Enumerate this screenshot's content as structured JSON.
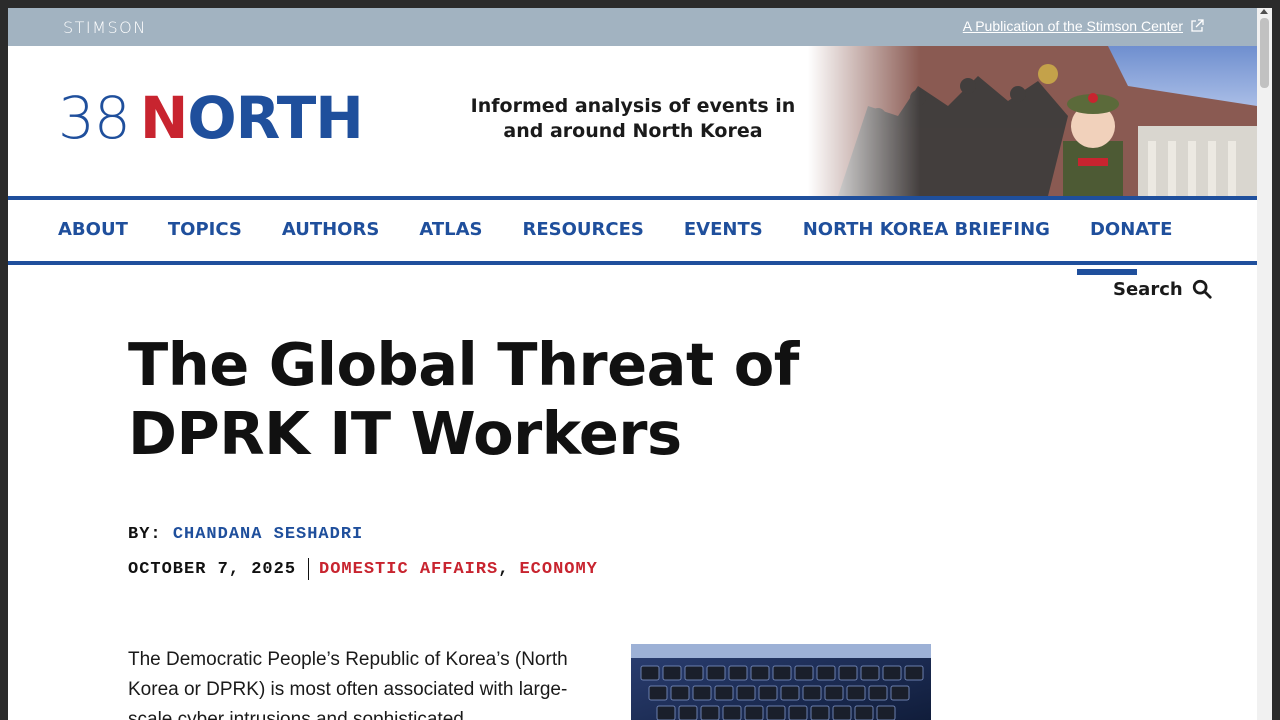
{
  "topbar": {
    "logo_text": "STIMSON",
    "publication_link": "A Publication of the Stimson Center"
  },
  "header": {
    "logo_number": "38",
    "logo_word_first": "N",
    "logo_word_rest": "ORTH",
    "tagline": "Informed analysis of events in and around North Korea"
  },
  "nav": {
    "items": [
      {
        "label": "ABOUT"
      },
      {
        "label": "TOPICS"
      },
      {
        "label": "AUTHORS"
      },
      {
        "label": "ATLAS"
      },
      {
        "label": "RESOURCES"
      },
      {
        "label": "EVENTS"
      },
      {
        "label": "NORTH KOREA BRIEFING"
      },
      {
        "label": "DONATE"
      }
    ]
  },
  "search": {
    "label": "Search"
  },
  "article": {
    "title": "The Global Threat of DPRK IT Workers",
    "by_label": "BY:",
    "author": "CHANDANA SESHADRI",
    "date": "OCTOBER 7, 2025",
    "categories": [
      "DOMESTIC AFFAIRS",
      "ECONOMY"
    ],
    "category_separator": ",",
    "body_start": "The Democratic People’s Republic of Korea’s (North Korea or DPRK) is most often associated with large-scale cyber intrusions and sophisticated"
  },
  "colors": {
    "brand_blue": "#1f4f9c",
    "brand_red": "#c8242f",
    "topbar_bg": "#a2b3c1"
  }
}
